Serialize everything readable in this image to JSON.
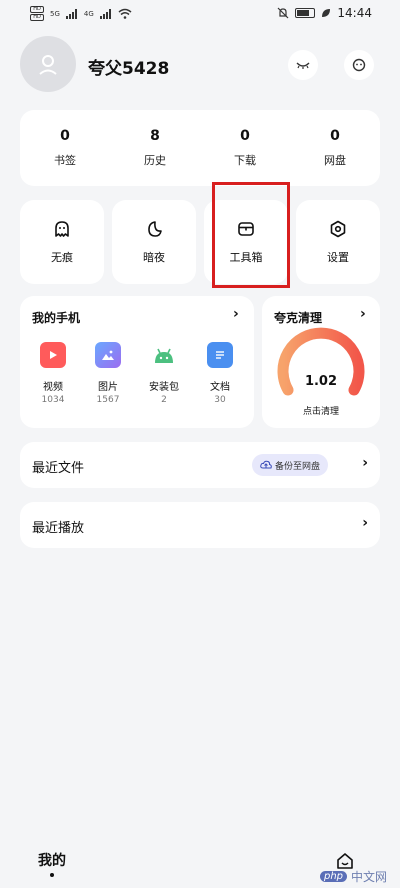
{
  "status": {
    "sim1": "HD",
    "sim2": "HD",
    "signal1": "5G",
    "signal2": "4G",
    "battery": "4",
    "time": "14:44"
  },
  "profile": {
    "username": "夸父5428"
  },
  "stats": [
    {
      "num": "0",
      "label": "书签"
    },
    {
      "num": "8",
      "label": "历史"
    },
    {
      "num": "0",
      "label": "下载"
    },
    {
      "num": "0",
      "label": "网盘"
    }
  ],
  "tools": [
    {
      "label": "无痕",
      "icon": "ghost-icon"
    },
    {
      "label": "暗夜",
      "icon": "moon-icon"
    },
    {
      "label": "工具箱",
      "icon": "toolbox-icon"
    },
    {
      "label": "设置",
      "icon": "settings-icon"
    }
  ],
  "phone": {
    "title": "我的手机",
    "chevron": "›",
    "items": [
      {
        "name": "视频",
        "count": "1034",
        "color": "#ff5b5b"
      },
      {
        "name": "图片",
        "count": "1567",
        "color": "#7b6cf0"
      },
      {
        "name": "安装包",
        "count": "2",
        "color": "#4cc080"
      },
      {
        "name": "文档",
        "count": "30",
        "color": "#4a8ff0"
      }
    ]
  },
  "clean": {
    "title": "夸克清理",
    "chevron": "›",
    "value": "1.02",
    "label": "点击清理"
  },
  "recent_files": {
    "title": "最近文件",
    "backup_label": "备份至网盘",
    "chevron": "›"
  },
  "recent_play": {
    "title": "最近播放",
    "chevron": "›"
  },
  "nav": {
    "mine": "我的"
  },
  "watermark": {
    "badge": "php",
    "text": "中文网"
  },
  "colors": {
    "highlight": "#d81f1f",
    "gauge_start": "#f7a36b",
    "gauge_end": "#f2574a"
  }
}
